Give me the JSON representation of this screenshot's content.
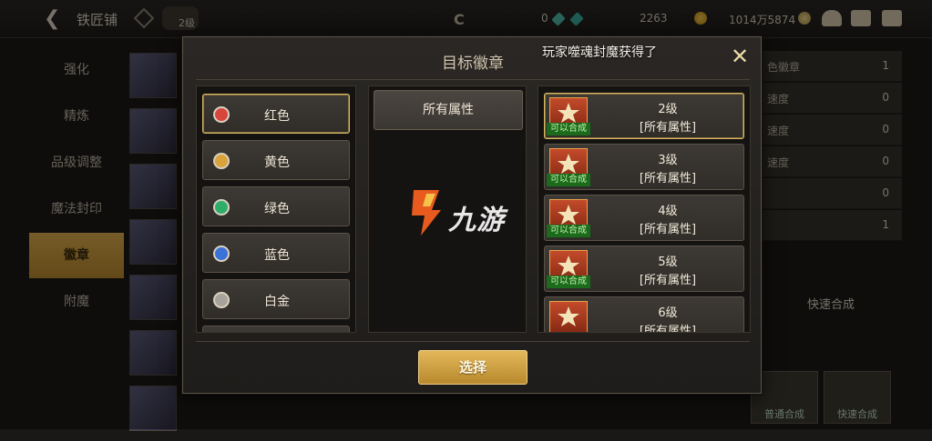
{
  "topbar": {
    "title": "铁匠铺",
    "badge": "2级",
    "currency_gems": "0",
    "currency_coins": "2263",
    "currency_gold": "1014万5874"
  },
  "left_nav": [
    {
      "label": "强化",
      "active": false
    },
    {
      "label": "精炼",
      "active": false
    },
    {
      "label": "品级调整",
      "active": false
    },
    {
      "label": "魔法封印",
      "active": false
    },
    {
      "label": "徽章",
      "active": true
    },
    {
      "label": "附魔",
      "active": false
    }
  ],
  "right_panel": {
    "rows": [
      {
        "label": "色徽章",
        "value": "1"
      },
      {
        "label": "速度",
        "value": "0"
      },
      {
        "label": "速度",
        "value": "0"
      },
      {
        "label": "速度",
        "value": "0"
      },
      {
        "label": "",
        "value": "0"
      },
      {
        "label": "",
        "value": "1"
      }
    ],
    "quick_synth": "快速合成",
    "normal_synth_btn": "普通合成",
    "quick_synth_btn": "快速合成"
  },
  "modal": {
    "title": "目标徽章",
    "toast": "玩家噬魂封魔获得了",
    "close_icon": "close-icon",
    "colors": [
      {
        "label": "红色",
        "color": "#d8453a",
        "selected": true
      },
      {
        "label": "黄色",
        "color": "#d9a23a",
        "selected": false
      },
      {
        "label": "绿色",
        "color": "#2fae6a",
        "selected": false
      },
      {
        "label": "蓝色",
        "color": "#3a72d8",
        "selected": false
      },
      {
        "label": "白金",
        "color": "#a7a29b",
        "selected": false
      }
    ],
    "attribute_label": "所有属性",
    "watermark": "九游",
    "levels": [
      {
        "title": "2级",
        "sub": "[所有属性]",
        "tag": "可以合成",
        "selected": true
      },
      {
        "title": "3级",
        "sub": "[所有属性]",
        "tag": "可以合成",
        "selected": false
      },
      {
        "title": "4级",
        "sub": "[所有属性]",
        "tag": "可以合成",
        "selected": false
      },
      {
        "title": "5级",
        "sub": "[所有属性]",
        "tag": "可以合成",
        "selected": false
      },
      {
        "title": "6级",
        "sub": "[所有属性]",
        "tag": "",
        "selected": false
      }
    ],
    "select_label": "选择"
  }
}
